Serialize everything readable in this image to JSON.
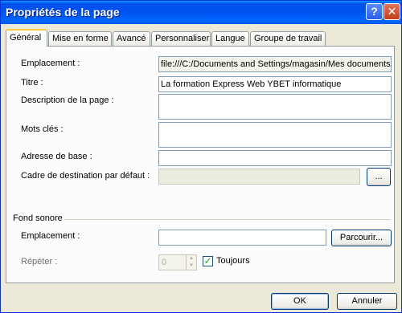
{
  "window": {
    "title": "Propriétés de la page",
    "help_glyph": "?",
    "close_glyph": "✕"
  },
  "tabs": [
    {
      "label": "Général",
      "active": true
    },
    {
      "label": "Mise en forme"
    },
    {
      "label": "Avancé"
    },
    {
      "label": "Personnaliser"
    },
    {
      "label": "Langue"
    },
    {
      "label": "Groupe de travail"
    }
  ],
  "general": {
    "location_label": "Emplacement :",
    "location_value": "file:///C:/Documents and Settings/magasin/Mes documents/",
    "title_label": "Titre :",
    "title_value": "La formation Express Web YBET informatique",
    "description_label": "Description de la page :",
    "description_value": "",
    "keywords_label": "Mots clés :",
    "keywords_value": "",
    "base_url_label": "Adresse de base :",
    "base_url_value": "",
    "target_frame_label": "Cadre de destination par défaut :",
    "target_frame_value": "",
    "target_frame_button": "..."
  },
  "sound": {
    "section_label": "Fond sonore",
    "location_label": "Emplacement :",
    "location_value": "",
    "browse_button": "Parcourir...",
    "repeat_label": "Répéter :",
    "repeat_value": "0",
    "always_label": "Toujours",
    "always_checked": true
  },
  "footer": {
    "ok_button": "OK",
    "cancel_button": "Annuler"
  }
}
